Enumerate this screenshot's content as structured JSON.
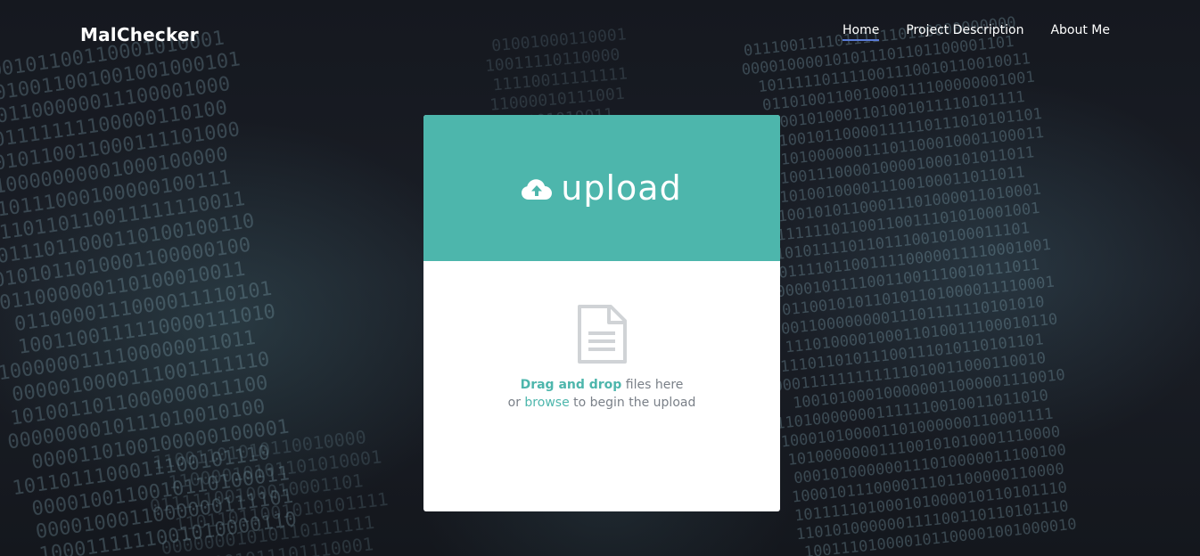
{
  "navbar": {
    "brand": "MalChecker",
    "links": [
      {
        "label": "Home",
        "active": true
      },
      {
        "label": "Project Description",
        "active": false
      },
      {
        "label": "About Me",
        "active": false
      }
    ]
  },
  "upload": {
    "title": "upload",
    "icon": "cloud-upload-icon",
    "drop_icon": "file-icon",
    "drop_strong": "Drag and drop",
    "drop_rest": " files here",
    "line2_prefix": "or ",
    "browse_label": "browse",
    "line2_suffix": " to begin the upload"
  },
  "colors": {
    "accent": "#4db6ac",
    "nav_underline": "#5a7bd6",
    "background": "#14171e",
    "card": "#ffffff",
    "muted_text": "#7a8088"
  }
}
